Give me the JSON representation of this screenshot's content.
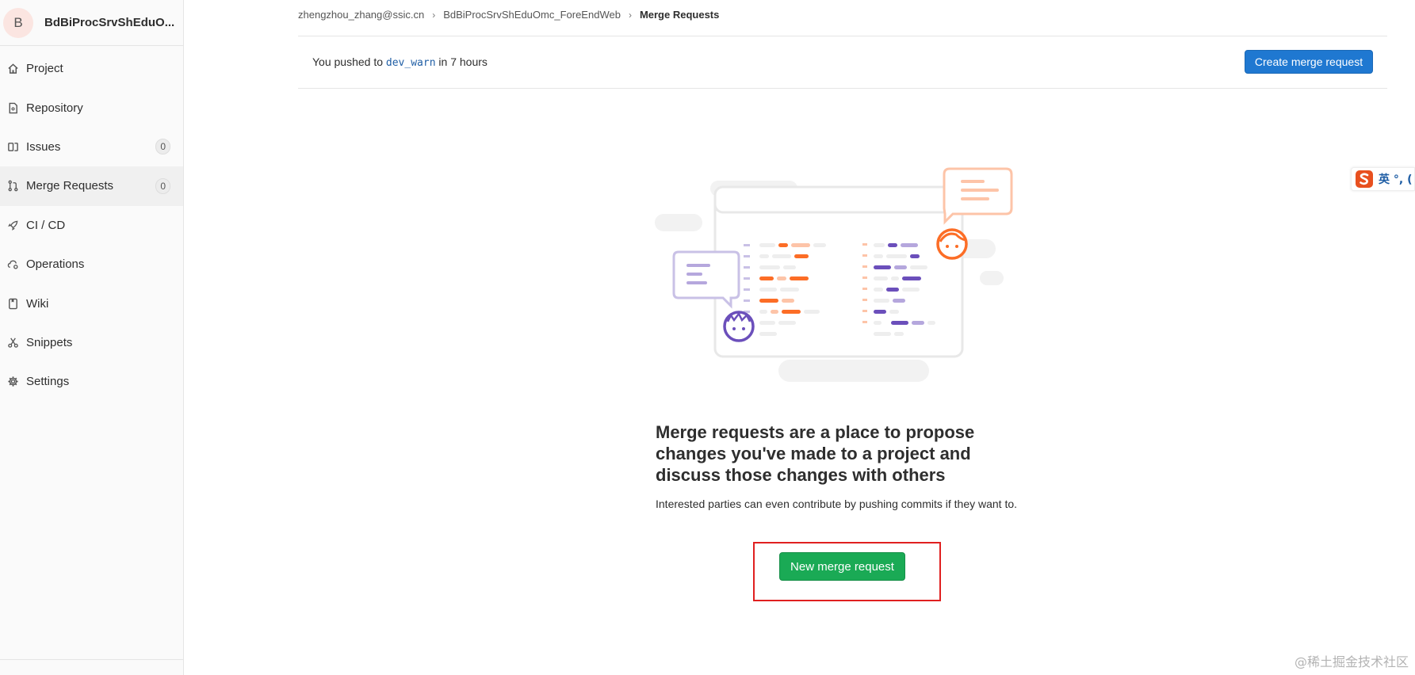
{
  "sidebar": {
    "avatar_letter": "B",
    "project_name": "BdBiProcSrvShEduO...",
    "items": [
      {
        "label": "Project",
        "icon": "home-icon"
      },
      {
        "label": "Repository",
        "icon": "doc-icon"
      },
      {
        "label": "Issues",
        "icon": "issues-icon",
        "count": "0"
      },
      {
        "label": "Merge Requests",
        "icon": "merge-request-icon",
        "count": "0",
        "active": true
      },
      {
        "label": "CI / CD",
        "icon": "rocket-icon"
      },
      {
        "label": "Operations",
        "icon": "cloud-gear-icon"
      },
      {
        "label": "Wiki",
        "icon": "book-icon"
      },
      {
        "label": "Snippets",
        "icon": "scissors-icon"
      },
      {
        "label": "Settings",
        "icon": "gear-icon"
      }
    ]
  },
  "breadcrumb": {
    "items": [
      "zhengzhou_zhang@ssic.cn",
      "BdBiProcSrvShEduOmc_ForeEndWeb",
      "Merge Requests"
    ]
  },
  "push_notice": {
    "prefix": "You pushed to",
    "branch": "dev_warn",
    "suffix": "in 7 hours"
  },
  "create_button": "Create merge request",
  "empty_state": {
    "title": "Merge requests are a place to propose changes you've made to a project and discuss those changes with others",
    "description": "Interested parties can even contribute by pushing commits if they want to.",
    "button": "New merge request"
  },
  "ime": {
    "text": "英 °, ("
  },
  "watermark": "@稀土掘金技术社区",
  "colors": {
    "primary_blue": "#1f78d1",
    "success_green": "#1aaa55",
    "highlight_red": "#e02020",
    "illustration_orange": "#fc6d26",
    "illustration_purple": "#6b4fbb"
  }
}
